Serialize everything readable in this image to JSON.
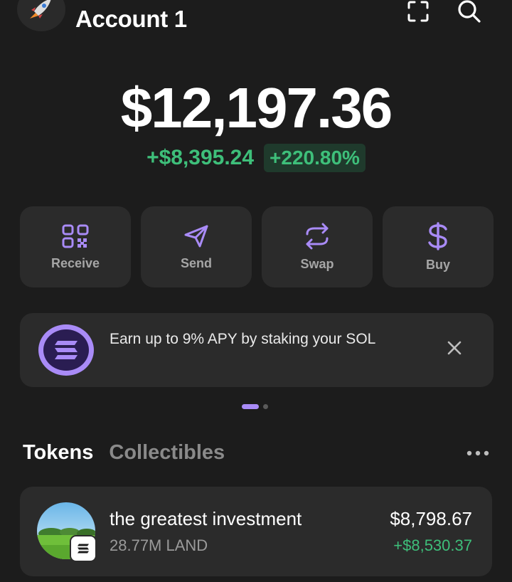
{
  "header": {
    "account_name": "Account 1",
    "avatar_icon": "rocket-icon",
    "scan_icon": "scan-icon",
    "search_icon": "search-icon"
  },
  "balance": {
    "total": "$12,197.36",
    "change_amount": "+$8,395.24",
    "change_percent": "+220.80%"
  },
  "actions": [
    {
      "label": "Receive",
      "icon": "qr-code-icon"
    },
    {
      "label": "Send",
      "icon": "send-icon"
    },
    {
      "label": "Swap",
      "icon": "swap-icon"
    },
    {
      "label": "Buy",
      "icon": "dollar-icon"
    }
  ],
  "banner": {
    "text": "Earn up to 9% APY by staking your SOL",
    "icon": "solana-icon",
    "close_icon": "close-icon"
  },
  "pager": {
    "pages": 2,
    "active": 1
  },
  "tabs": [
    {
      "label": "Tokens",
      "active": true
    },
    {
      "label": "Collectibles",
      "active": false
    }
  ],
  "tokens": [
    {
      "name": "the greatest investment",
      "amount": "28.77M LAND",
      "value": "$8,798.67",
      "change": "+$8,530.37"
    }
  ],
  "colors": {
    "background": "#1c1c1c",
    "card": "#2b2b2b",
    "accent": "#a98bf7",
    "positive": "#3ebf7a"
  }
}
